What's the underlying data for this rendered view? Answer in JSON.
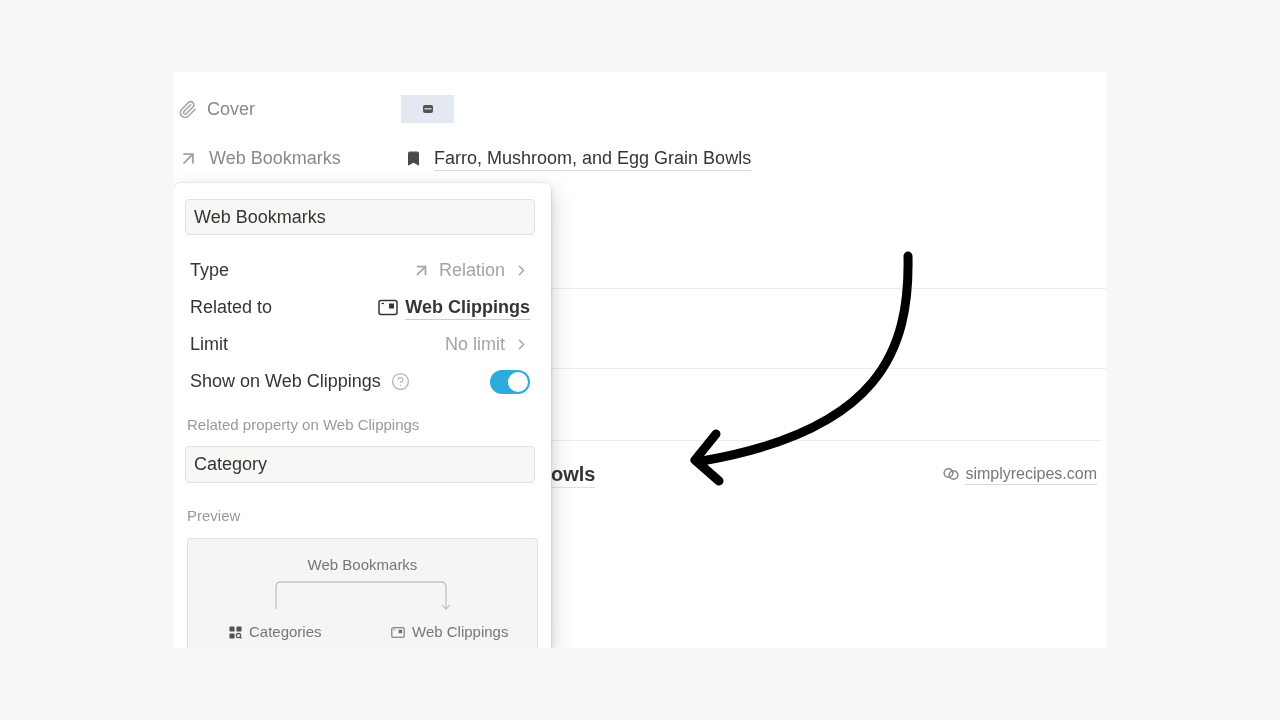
{
  "properties": [
    {
      "kind": "file",
      "label": "Cover"
    },
    {
      "kind": "relation",
      "label": "Web Bookmarks",
      "value": "Farro, Mushroom, and Egg Grain Bowls"
    }
  ],
  "background_row": {
    "title": "owls",
    "source": "simplyrecipes.com"
  },
  "popup": {
    "name_field": "Web Bookmarks",
    "settings": [
      {
        "kind": "type",
        "label": "Type",
        "value": "Relation"
      },
      {
        "kind": "database",
        "label": "Related to",
        "value": "Web Clippings"
      },
      {
        "kind": "select",
        "label": "Limit",
        "value": "No limit"
      },
      {
        "kind": "toggle",
        "label": "Show on Web Clippings",
        "on": true
      }
    ],
    "related_property": {
      "label": "Related property on Web Clippings",
      "value": "Category"
    },
    "preview": {
      "label": "Preview",
      "relation": "Web Bookmarks",
      "source": "Categories",
      "target": "Web Clippings"
    }
  }
}
